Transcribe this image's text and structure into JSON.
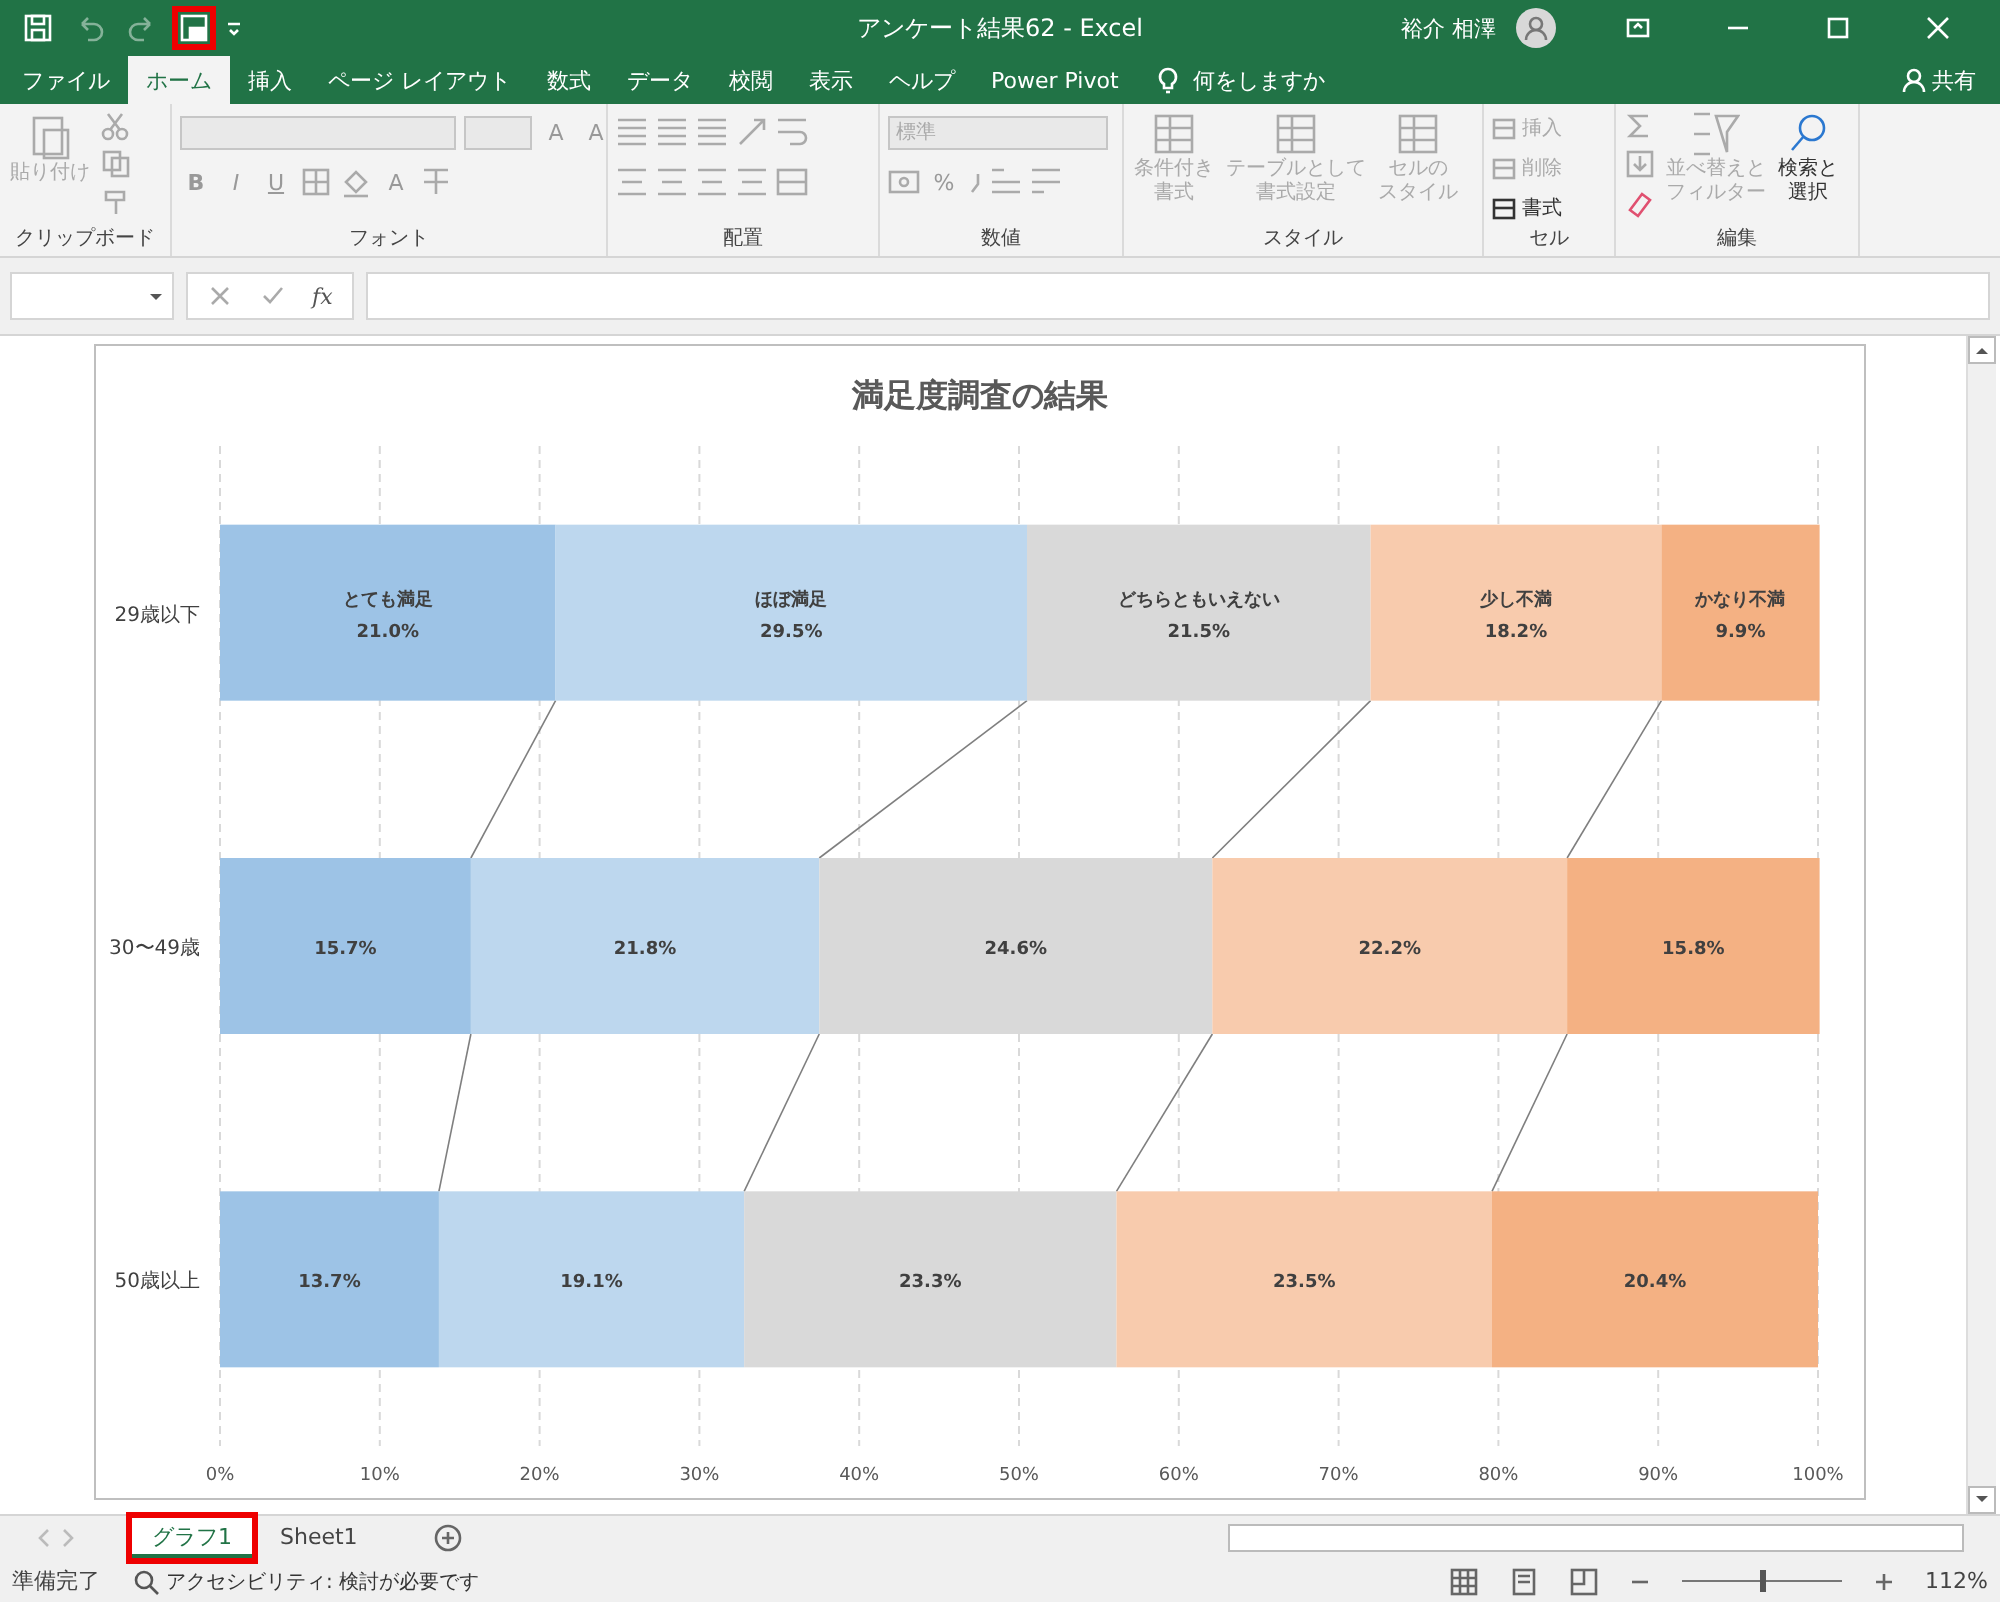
{
  "title_bar": {
    "title": "アンケート結果62 - Excel",
    "user": "裕介 相澤",
    "qat": [
      {
        "kind": "save",
        "disabled": false,
        "highlighted": false
      },
      {
        "kind": "undo",
        "disabled": true,
        "highlighted": false
      },
      {
        "kind": "redo",
        "disabled": true,
        "highlighted": false
      },
      {
        "kind": "form",
        "disabled": false,
        "highlighted": true
      }
    ]
  },
  "ribbon_tabs": [
    {
      "label": "ファイル",
      "selected": false
    },
    {
      "label": "ホーム",
      "selected": true
    },
    {
      "label": "挿入",
      "selected": false
    },
    {
      "label": "ページ レイアウト",
      "selected": false
    },
    {
      "label": "数式",
      "selected": false
    },
    {
      "label": "データ",
      "selected": false
    },
    {
      "label": "校閲",
      "selected": false
    },
    {
      "label": "表示",
      "selected": false
    },
    {
      "label": "ヘルプ",
      "selected": false
    },
    {
      "label": "Power Pivot",
      "selected": false
    }
  ],
  "tell_me": "何をしますか",
  "share": "共有",
  "ribbon": {
    "clipboard": {
      "label": "クリップボード",
      "paste": "貼り付け"
    },
    "font": {
      "label": "フォント",
      "bold": "B",
      "italic": "I",
      "underline": "U",
      "font_color_glyph": "A",
      "grow": "A",
      "shrink": "A"
    },
    "alignment": {
      "label": "配置"
    },
    "number": {
      "label": "数値",
      "format": "標準",
      "percent": "%"
    },
    "styles": {
      "label": "スタイル",
      "buttons": [
        {
          "lines": [
            "条件付き",
            "書式"
          ],
          "disabled": true
        },
        {
          "lines": [
            "テーブルとして",
            "書式設定"
          ],
          "disabled": true
        },
        {
          "lines": [
            "セルの",
            "スタイル"
          ],
          "disabled": true
        }
      ]
    },
    "cells": {
      "label": "セル",
      "buttons": [
        {
          "label": "挿入",
          "disabled": true
        },
        {
          "label": "削除",
          "disabled": true
        },
        {
          "label": "書式",
          "disabled": false
        }
      ]
    },
    "editing": {
      "label": "編集",
      "buttons": [
        {
          "lines": [
            "並べ替えと",
            "フィルター"
          ],
          "disabled": true
        },
        {
          "lines": [
            "検索と",
            "選択"
          ],
          "disabled": false
        }
      ]
    }
  },
  "formula_bar": {
    "function_label": "fx"
  },
  "chart": {
    "chart_data": {
      "type": "bar",
      "orientation": "horizontal",
      "stacked": true,
      "grid": true,
      "title": "満足度調査の結果",
      "categories": [
        "29歳以下",
        "30〜49歳",
        "50歳以上"
      ],
      "xlim": [
        0,
        100
      ],
      "xticks": [
        {
          "value": 0,
          "label": "0%"
        },
        {
          "value": 10,
          "label": "10%"
        },
        {
          "value": 20,
          "label": "20%"
        },
        {
          "value": 30,
          "label": "30%"
        },
        {
          "value": 40,
          "label": "40%"
        },
        {
          "value": 50,
          "label": "50%"
        },
        {
          "value": 60,
          "label": "60%"
        },
        {
          "value": 70,
          "label": "70%"
        },
        {
          "value": 80,
          "label": "80%"
        },
        {
          "value": 90,
          "label": "90%"
        },
        {
          "value": 100,
          "label": "100%"
        }
      ],
      "value_labels": [
        [
          "21.0%",
          "15.7%",
          "13.7%"
        ],
        [
          "29.5%",
          "21.8%",
          "19.1%"
        ],
        [
          "21.5%",
          "24.6%",
          "23.3%"
        ],
        [
          "18.2%",
          "22.2%",
          "23.5%"
        ],
        [
          "9.9%",
          "15.8%",
          "20.4%"
        ]
      ],
      "series": [
        {
          "name": "とても満足",
          "color": "#9dc3e6",
          "values": [
            21.0,
            15.7,
            13.7
          ]
        },
        {
          "name": "ほぼ満足",
          "color": "#bdd7ee",
          "values": [
            29.5,
            21.8,
            19.1
          ]
        },
        {
          "name": "どちらともいえない",
          "color": "#d9d9d9",
          "values": [
            21.5,
            24.6,
            23.3
          ]
        },
        {
          "name": "少し不満",
          "color": "#f8cbad",
          "values": [
            18.2,
            22.2,
            23.5
          ]
        },
        {
          "name": "かなり不満",
          "color": "#f4b183",
          "values": [
            9.9,
            15.8,
            20.4
          ]
        }
      ]
    }
  },
  "sheet_tabs": [
    {
      "label": "グラフ1",
      "selected": true,
      "highlighted": true
    },
    {
      "label": "Sheet1",
      "selected": false,
      "highlighted": false
    }
  ],
  "status_bar": {
    "status": "準備完了",
    "accessibility": "アクセシビリティ: 検討が必要です",
    "zoom": "112%",
    "zoom_slider": {
      "level": 0.5
    }
  }
}
